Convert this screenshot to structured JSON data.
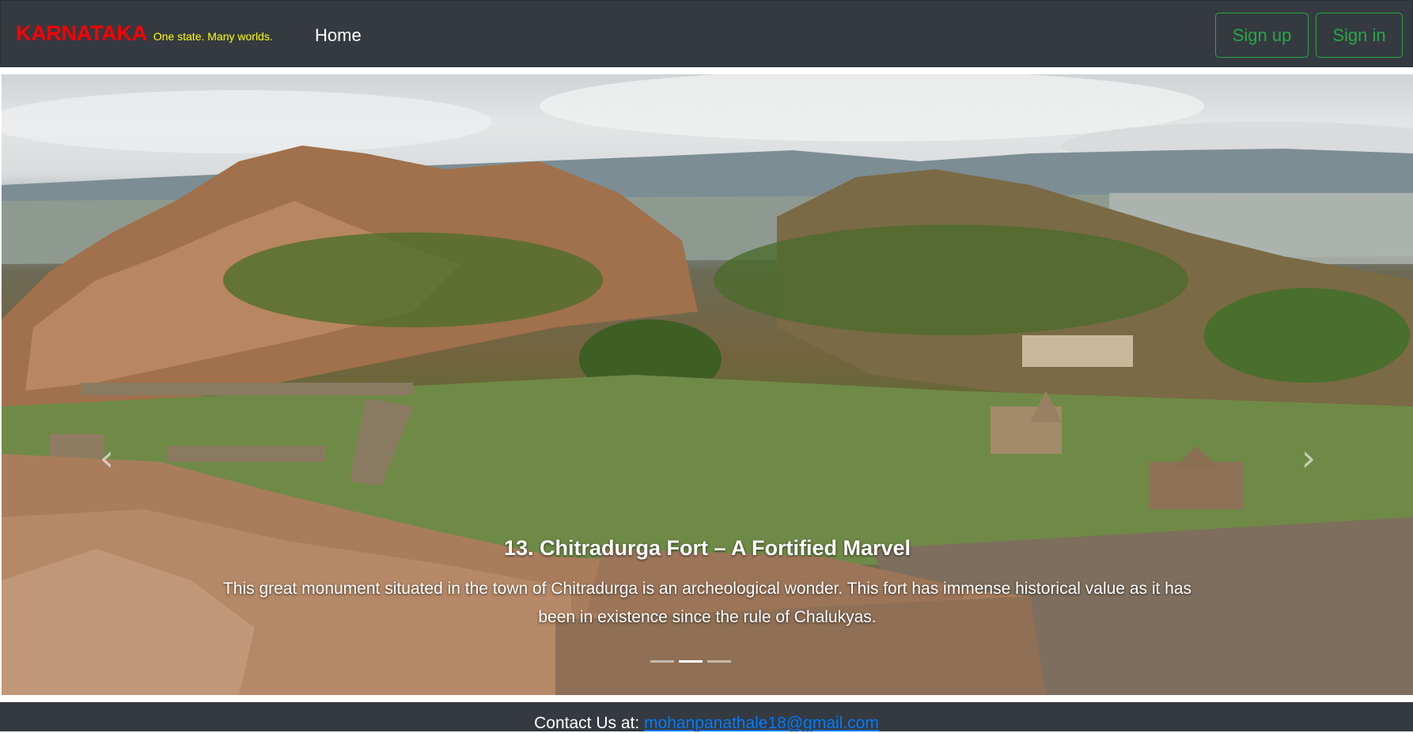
{
  "navbar": {
    "brand_name": "KARNATAKA",
    "tagline": "One state. Many worlds.",
    "home_link": "Home",
    "signup_label": "Sign up",
    "signin_label": "Sign in"
  },
  "carousel": {
    "prev_glyph": "‹",
    "next_glyph": "›",
    "caption_title": "13. Chitradurga Fort – A Fortified Marvel",
    "caption_text": "This great monument situated in the town of Chitradurga is an archeological wonder. This fort has immense historical value as it has been in existence since the rule of Chalukyas.",
    "indicator_count": 3,
    "active_indicator": 1
  },
  "footer": {
    "contact_label": "Contact Us at: ",
    "email": "mohanpanathale18@gmail.com"
  },
  "colors": {
    "navbar_bg": "#343a40",
    "brand": "#ff0000",
    "tagline": "#ffff00",
    "button_outline": "#28a745",
    "link": "#007bff"
  }
}
